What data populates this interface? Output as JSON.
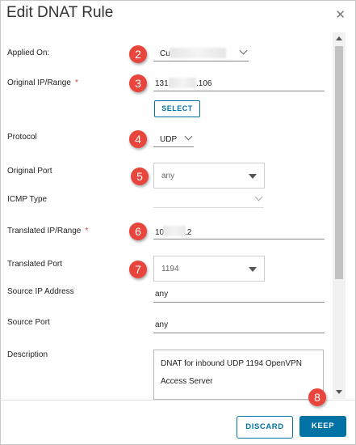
{
  "dialog": {
    "title": "Edit DNAT Rule",
    "close_icon": "close-icon"
  },
  "fields": {
    "applied_on": {
      "label": "Applied On:",
      "value_prefix": "Cu"
    },
    "original_ip": {
      "label": "Original IP/Range",
      "required": "*",
      "value_prefix": "131.",
      "value_suffix": ".106"
    },
    "select_button": "SELECT",
    "protocol": {
      "label": "Protocol",
      "value": "UDP"
    },
    "original_port": {
      "label": "Original Port",
      "value": "any"
    },
    "icmp_type": {
      "label": "ICMP Type",
      "value": ""
    },
    "translated_ip": {
      "label": "Translated IP/Range",
      "required": "*",
      "value_prefix": "10.",
      "value_suffix": ".2"
    },
    "translated_port": {
      "label": "Translated Port",
      "value": "1194"
    },
    "source_ip": {
      "label": "Source IP Address",
      "value": "any"
    },
    "source_port": {
      "label": "Source Port",
      "value": "any"
    },
    "description": {
      "label": "Description",
      "value": "DNAT for inbound UDP 1194 OpenVPN Access Server"
    }
  },
  "badges": [
    "2",
    "3",
    "4",
    "5",
    "6",
    "7",
    "8"
  ],
  "footer": {
    "discard": "DISCARD",
    "keep": "KEEP"
  },
  "colors": {
    "accent": "#0072a3",
    "badge": "#e8453c",
    "required": "#d43f3a"
  }
}
